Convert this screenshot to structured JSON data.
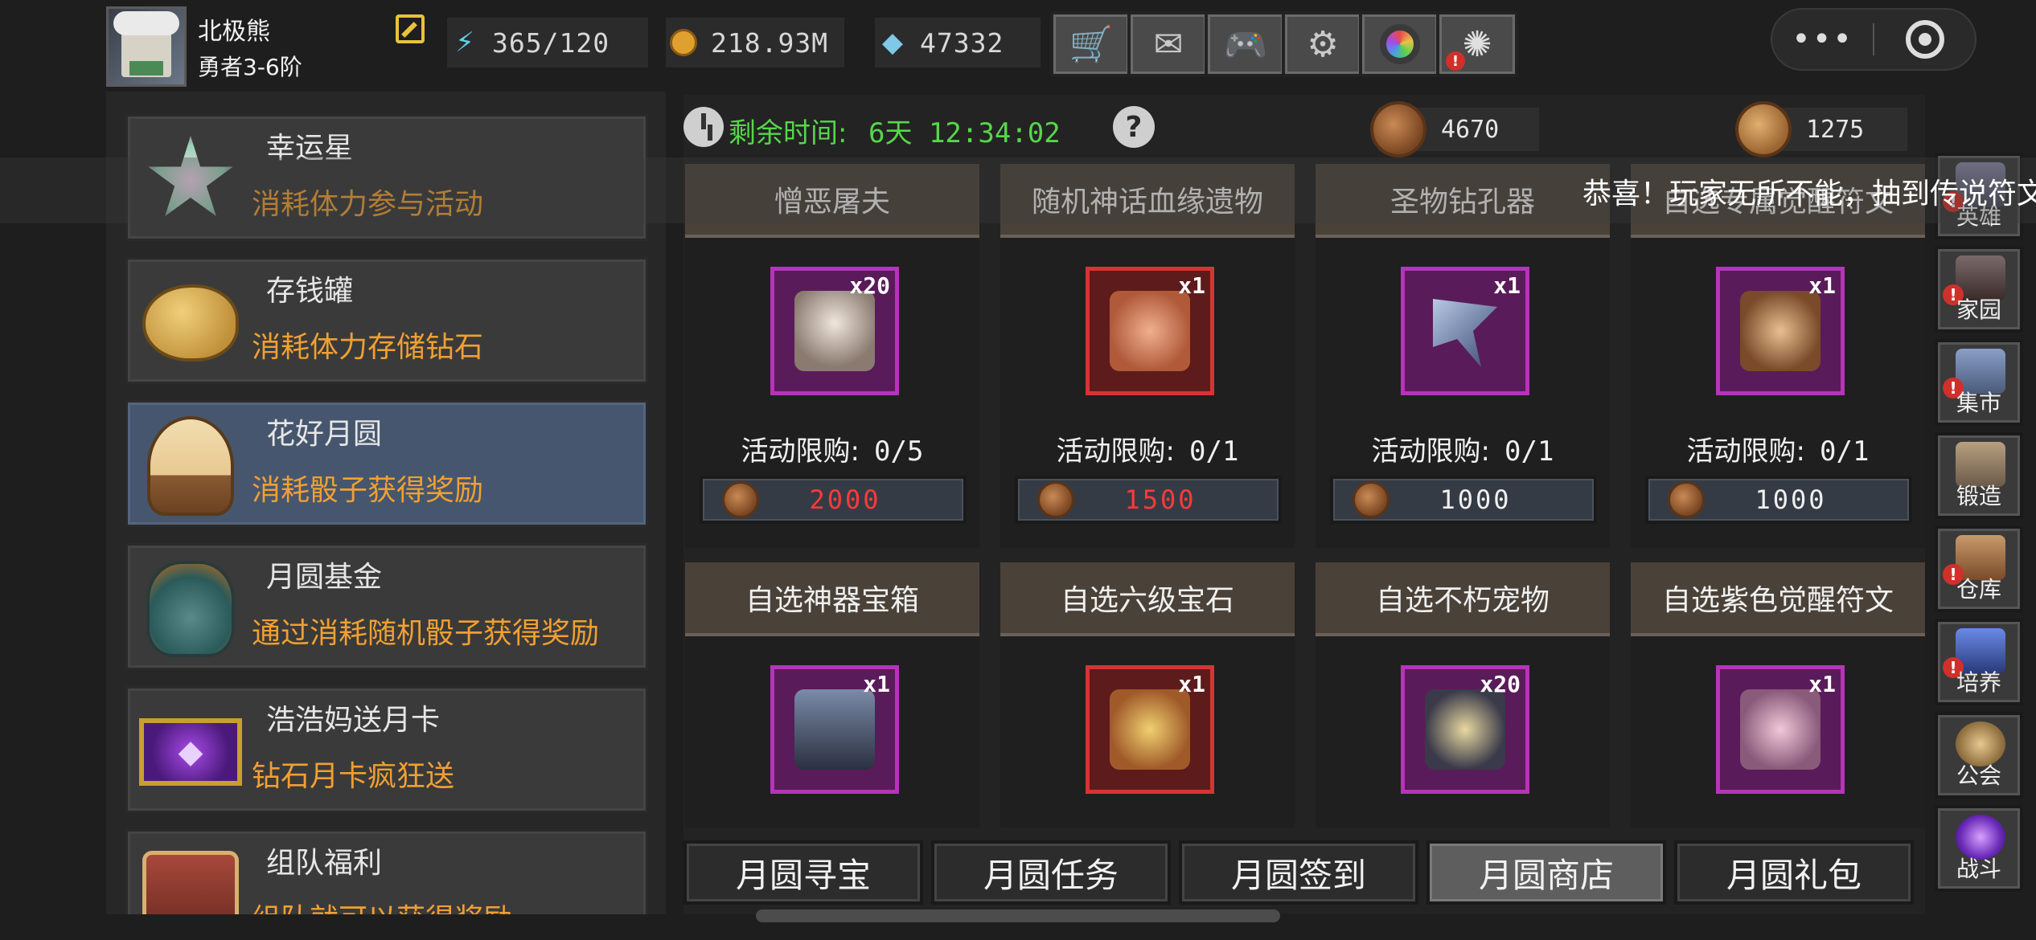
{
  "player": {
    "name": "北极熊",
    "rank": "勇者3-6阶"
  },
  "resources": {
    "energy": "365/120",
    "coins": "218.93M",
    "diamonds": "47332"
  },
  "toolbar": {
    "icons": [
      "shop-cart-icon",
      "mail-icon",
      "gamepad-icon",
      "gear-icon",
      "camera-aperture-icon",
      "fireworks-icon"
    ]
  },
  "capsule": {
    "more_label": "•••"
  },
  "sidebar_menu": {
    "items": [
      {
        "title": "幸运星",
        "desc": "消耗体力参与活动"
      },
      {
        "title": "存钱罐",
        "desc": "消耗体力存储钻石"
      },
      {
        "title": "花好月圆",
        "desc": "消耗骰子获得奖励"
      },
      {
        "title": "月圆基金",
        "desc": "通过消耗随机骰子获得奖励"
      },
      {
        "title": "浩浩妈送月卡",
        "desc": "钻石月卡疯狂送"
      },
      {
        "title": "组队福利",
        "desc": "组队就可以获得奖励"
      }
    ]
  },
  "event": {
    "timer_label": "剩余时间:",
    "timer_value": "6天 12:34:02",
    "help_label": "?",
    "currency_a": "4670",
    "currency_b": "1275"
  },
  "shop": {
    "items": [
      {
        "title": "憎恶屠夫",
        "qty": "x20",
        "limit_label": "活动限购:",
        "limit": "0/5",
        "price": "2000",
        "price_red": true,
        "frame": "purple"
      },
      {
        "title": "随机神话血缘遗物",
        "qty": "x1",
        "limit_label": "活动限购:",
        "limit": "0/1",
        "price": "1500",
        "price_red": true,
        "frame": "red"
      },
      {
        "title": "圣物钻孔器",
        "qty": "x1",
        "limit_label": "活动限购:",
        "limit": "0/1",
        "price": "1000",
        "price_red": false,
        "frame": "purple"
      },
      {
        "title": "自选专属觉醒符文",
        "qty": "x1",
        "limit_label": "活动限购:",
        "limit": "0/1",
        "price": "1000",
        "price_red": false,
        "frame": "purple"
      },
      {
        "title": "自选神器宝箱",
        "qty": "x1",
        "frame": "purple"
      },
      {
        "title": "自选六级宝石",
        "qty": "x1",
        "frame": "red"
      },
      {
        "title": "自选不朽宠物",
        "qty": "x20",
        "frame": "purple"
      },
      {
        "title": "自选紫色觉醒符文",
        "qty": "x1",
        "frame": "purple"
      }
    ]
  },
  "tabs": [
    {
      "label": "月圆寻宝",
      "active": false
    },
    {
      "label": "月圆任务",
      "active": false
    },
    {
      "label": "月圆签到",
      "active": false
    },
    {
      "label": "月圆商店",
      "active": true
    },
    {
      "label": "月圆礼包",
      "active": false
    }
  ],
  "right_nav": [
    {
      "label": "英雄",
      "alert": true
    },
    {
      "label": "家园",
      "alert": true
    },
    {
      "label": "集市",
      "alert": true
    },
    {
      "label": "锻造",
      "alert": false
    },
    {
      "label": "仓库",
      "alert": true
    },
    {
      "label": "培养",
      "alert": true
    },
    {
      "label": "公会",
      "alert": false
    },
    {
      "label": "战斗",
      "alert": false
    }
  ],
  "marquee": {
    "text": "恭喜！玩家无所不能，抽到传说符文"
  },
  "colors": {
    "accent_orange": "#f0a032",
    "timer_green": "#57d64a",
    "price_red": "#ff3a3a",
    "frame_purple": "#b733b9",
    "frame_red": "#d63434",
    "active_menu": "#46566e"
  }
}
